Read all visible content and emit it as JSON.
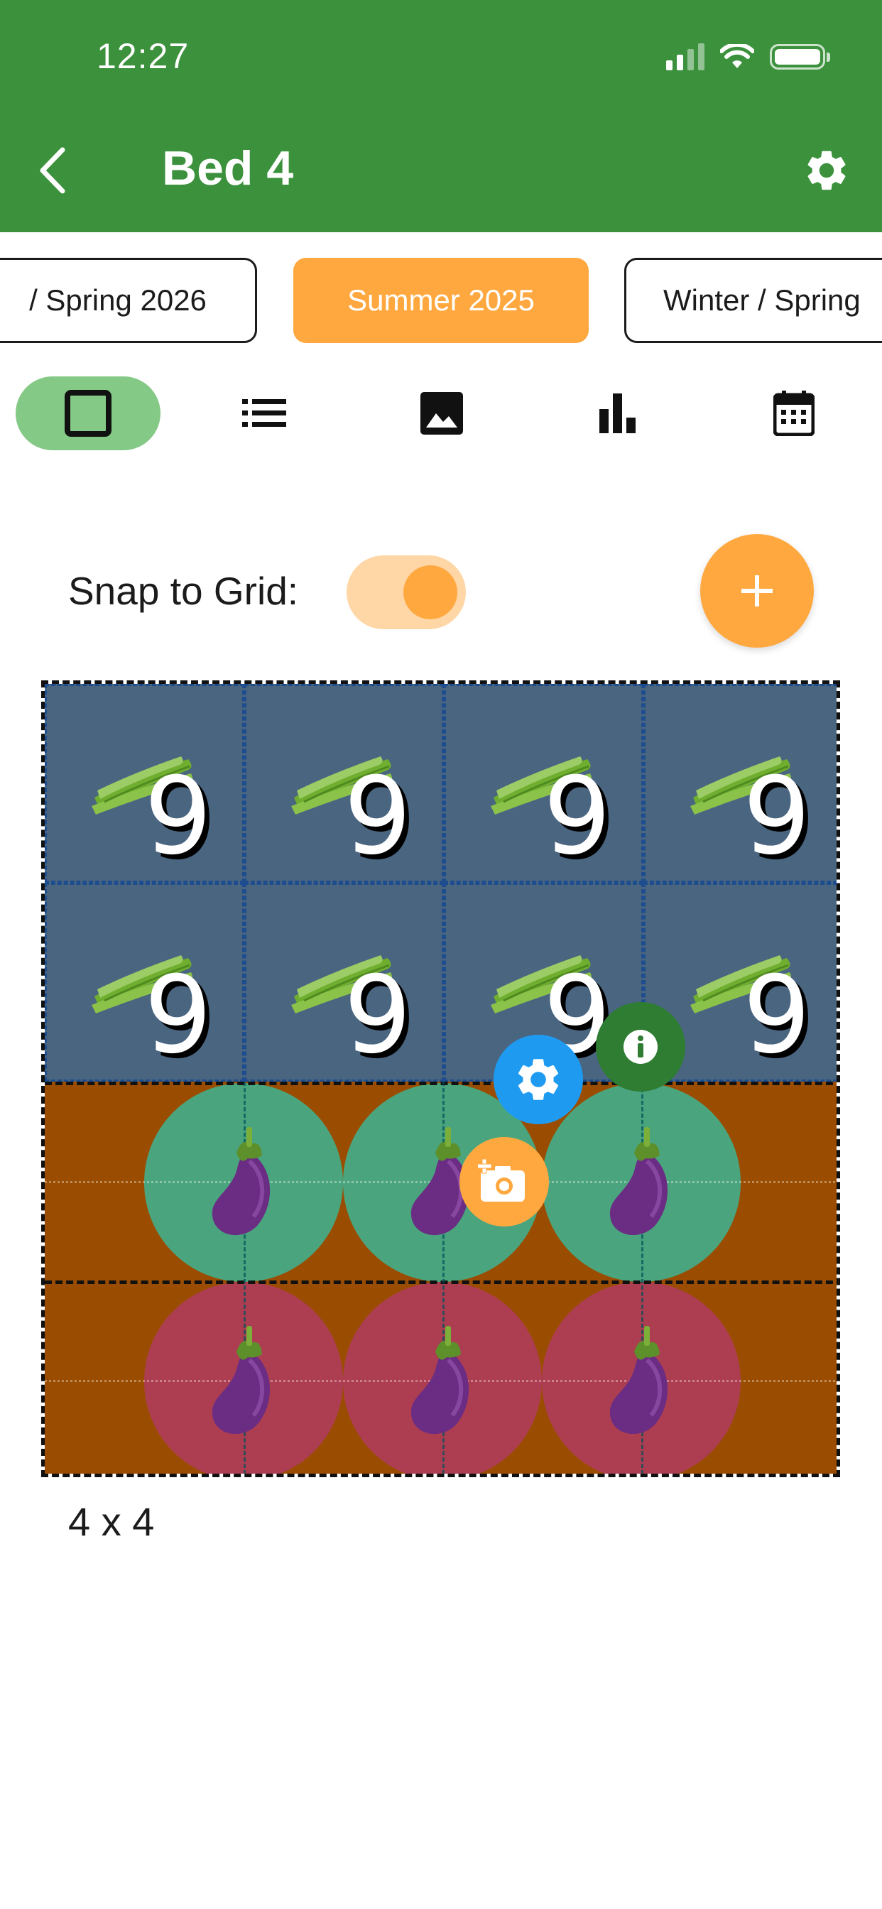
{
  "status_bar": {
    "time": "12:27"
  },
  "header": {
    "title": "Bed 4",
    "back_icon": "chevron-left-icon",
    "settings_icon": "gear-icon"
  },
  "seasons": [
    {
      "label": "/ Spring 2026",
      "active": false
    },
    {
      "label": "Summer 2025",
      "active": true
    },
    {
      "label": "Winter / Spring",
      "active": false
    }
  ],
  "view_tabs": [
    {
      "name": "grid",
      "icon": "square-icon",
      "active": true
    },
    {
      "name": "list",
      "icon": "list-icon",
      "active": false
    },
    {
      "name": "photos",
      "icon": "image-icon",
      "active": false
    },
    {
      "name": "stats",
      "icon": "bar-chart-icon",
      "active": false
    },
    {
      "name": "calendar",
      "icon": "calendar-icon",
      "active": false
    }
  ],
  "snap": {
    "label": "Snap to Grid:",
    "enabled": true
  },
  "add_button": {
    "icon": "plus-icon"
  },
  "bed": {
    "dimensions": "4 x 4",
    "colors": {
      "top_section": "#4a6580",
      "bottom_section": "#9a4d00",
      "green_circle": "#4aa57e",
      "red_circle": "#ad3e52"
    },
    "bean_cells": [
      "9",
      "9",
      "9",
      "9",
      "9",
      "9",
      "9",
      "9"
    ],
    "eggplant_rows": [
      {
        "color": "green",
        "plants": [
          "eggplant",
          "eggplant",
          "eggplant"
        ]
      },
      {
        "color": "red",
        "plants": [
          "eggplant",
          "eggplant",
          "eggplant"
        ]
      }
    ]
  },
  "selection_actions": [
    {
      "name": "info",
      "icon": "info-icon",
      "color": "#2e7d32"
    },
    {
      "name": "settings",
      "icon": "gear-icon",
      "color": "#1e9bf0"
    },
    {
      "name": "add-photo",
      "icon": "camera-plus-icon",
      "color": "#ffa840"
    }
  ]
}
